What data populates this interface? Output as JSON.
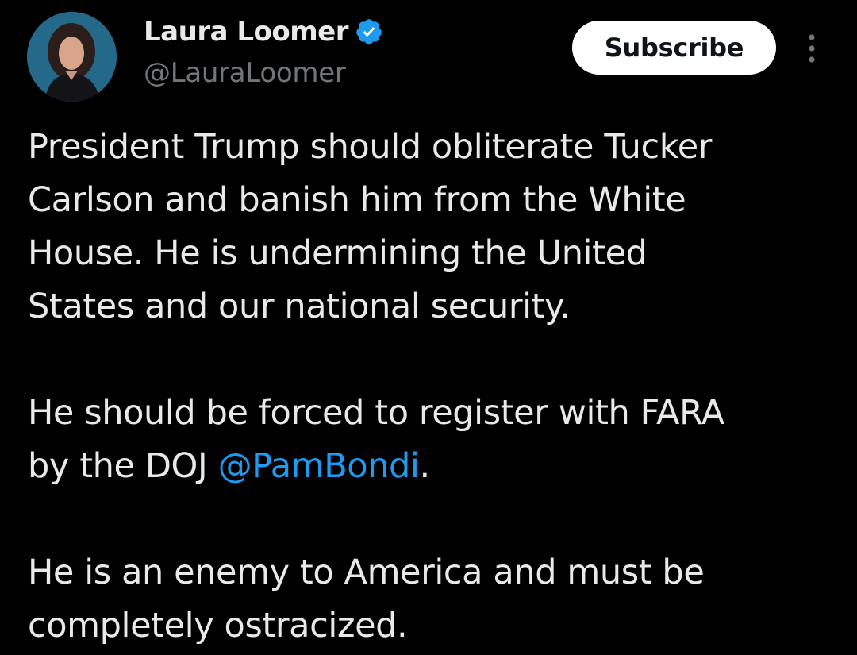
{
  "author": {
    "display_name": "Laura Loomer",
    "handle": "@LauraLoomer",
    "verified_icon": "verified-badge-icon",
    "verified_color": "#1d9bf0"
  },
  "actions": {
    "subscribe_label": "Subscribe",
    "more_icon": "more-vertical-icon"
  },
  "tweet": {
    "paragraph_1": [
      "President Trump should obliterate Tucker",
      "Carlson and banish him from the White",
      "House. He is undermining the United",
      "States and our national security."
    ],
    "paragraph_2_line_1": "He should be forced to register with FARA",
    "paragraph_2_line_2_prefix": "by the DOJ ",
    "paragraph_2_mention": "@PamBondi",
    "paragraph_2_line_2_suffix": ".",
    "paragraph_3": [
      "He is an enemy to America and must be",
      "completely ostracized."
    ]
  },
  "colors": {
    "background": "#000000",
    "text": "#e7e9ea",
    "muted": "#71767b",
    "link": "#1d9bf0"
  }
}
